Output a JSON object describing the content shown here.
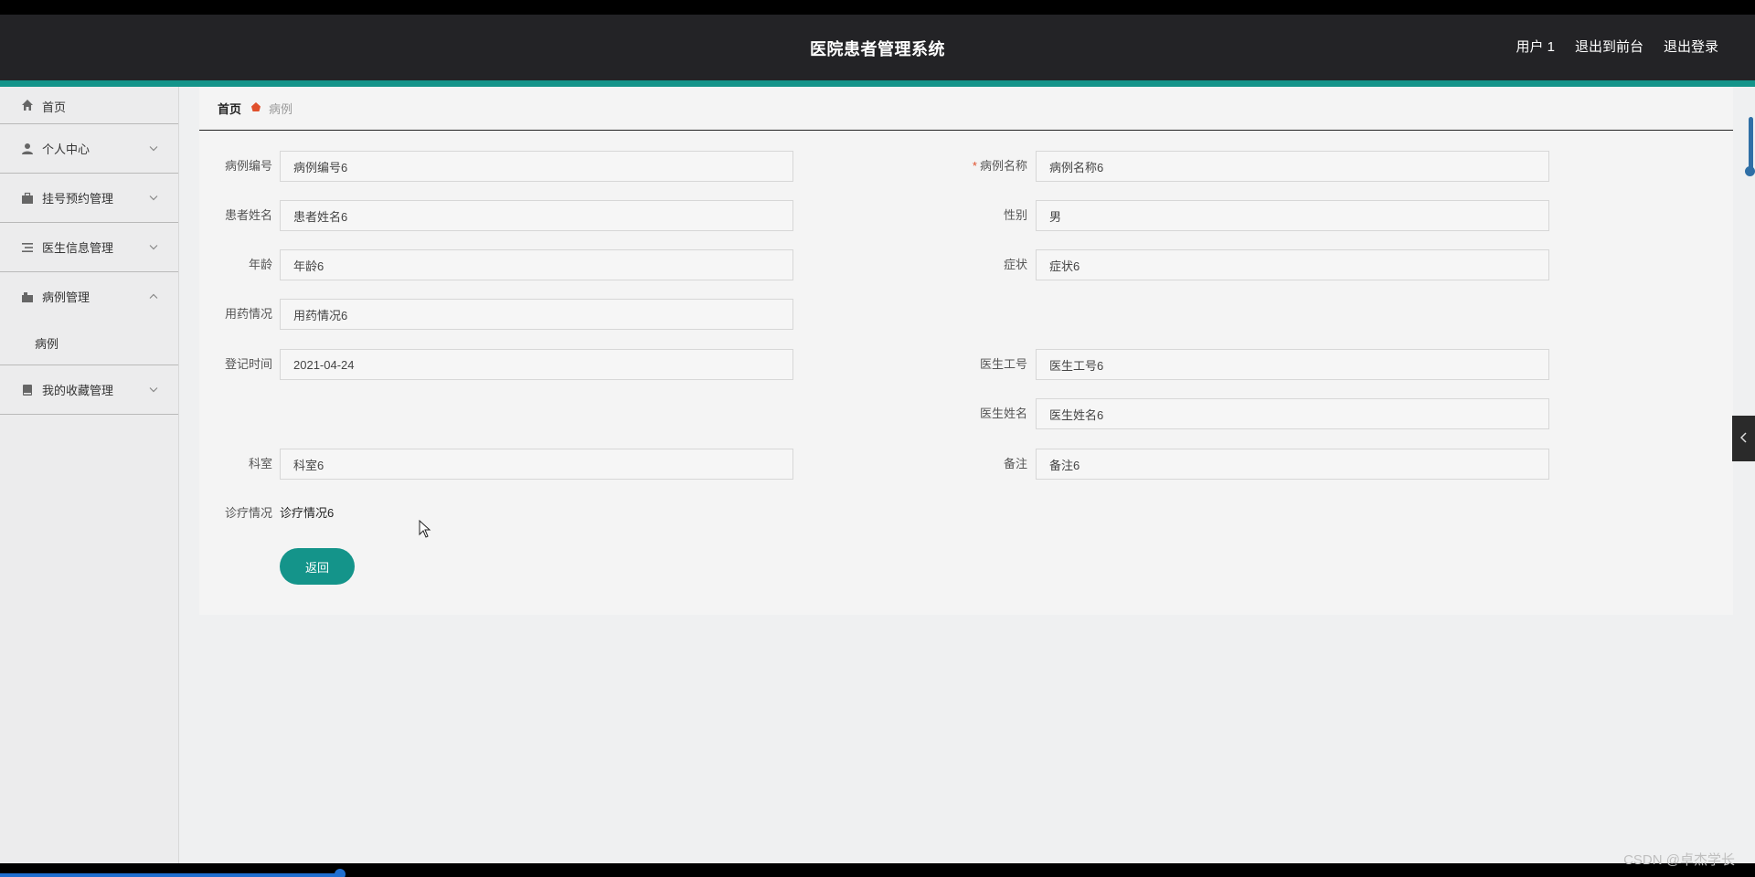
{
  "header": {
    "title": "医院患者管理系统",
    "user": "用户 1",
    "front": "退出到前台",
    "logout": "退出登录"
  },
  "sidebar": {
    "items": [
      {
        "label": "首页",
        "icon": "home-icon"
      },
      {
        "label": "个人中心",
        "icon": "user-icon"
      },
      {
        "label": "挂号预约管理",
        "icon": "briefcase-icon"
      },
      {
        "label": "医生信息管理",
        "icon": "list-icon"
      },
      {
        "label": "病例管理",
        "icon": "case-icon",
        "sub": [
          "病例"
        ]
      },
      {
        "label": "我的收藏管理",
        "icon": "book-icon"
      }
    ]
  },
  "breadcrumb": {
    "home": "首页",
    "current": "病例"
  },
  "form": {
    "case_no": {
      "label": "病例编号",
      "value": "病例编号6"
    },
    "case_name": {
      "label": "病例名称",
      "value": "病例名称6",
      "required_mark": "*"
    },
    "patient_name": {
      "label": "患者姓名",
      "value": "患者姓名6"
    },
    "gender": {
      "label": "性别",
      "value": "男"
    },
    "age": {
      "label": "年龄",
      "value": "年龄6"
    },
    "symptom": {
      "label": "症状",
      "value": "症状6"
    },
    "medication": {
      "label": "用药情况",
      "value": "用药情况6"
    },
    "register_time": {
      "label": "登记时间",
      "value": "2021-04-24"
    },
    "doctor_no": {
      "label": "医生工号",
      "value": "医生工号6"
    },
    "doctor_name": {
      "label": "医生姓名",
      "value": "医生姓名6"
    },
    "department": {
      "label": "科室",
      "value": "科室6"
    },
    "remark": {
      "label": "备注",
      "value": "备注6"
    },
    "diagnosis": {
      "label": "诊疗情况",
      "value": "诊疗情况6"
    },
    "back_label": "返回"
  },
  "watermark": "CSDN @卓杰学长",
  "colors": {
    "accent": "#14948a",
    "header": "#232326",
    "required": "#e0502c"
  }
}
